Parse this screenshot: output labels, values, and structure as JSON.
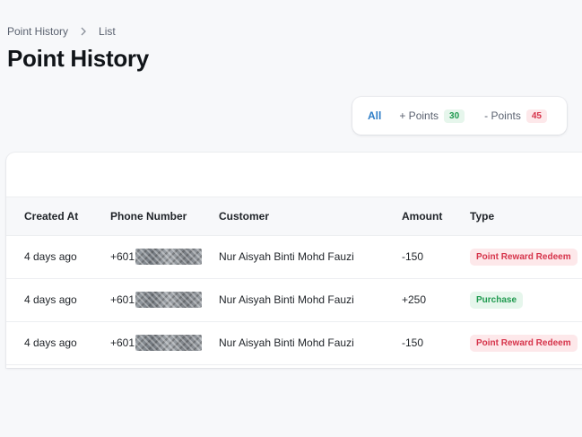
{
  "breadcrumb": {
    "parent": "Point History",
    "current": "List"
  },
  "page_title": "Point History",
  "filters": {
    "all": "All",
    "plus": {
      "label": "+ Points",
      "count": "30"
    },
    "minus": {
      "label": "- Points",
      "count": "45"
    }
  },
  "table": {
    "headers": [
      "Created At",
      "Phone Number",
      "Customer",
      "Amount",
      "Type"
    ],
    "rows": [
      {
        "created_at": "4 days ago",
        "phone_prefix": "+601",
        "customer": "Nur Aisyah Binti Mohd Fauzi",
        "amount": "-150",
        "type": "Point Reward Redeem",
        "type_color": "red"
      },
      {
        "created_at": "4 days ago",
        "phone_prefix": "+601",
        "customer": "Nur Aisyah Binti Mohd Fauzi",
        "amount": "+250",
        "type": "Purchase",
        "type_color": "green"
      },
      {
        "created_at": "4 days ago",
        "phone_prefix": "+601",
        "customer": "Nur Aisyah Binti Mohd Fauzi",
        "amount": "-150",
        "type": "Point Reward Redeem",
        "type_color": "red"
      }
    ]
  },
  "colors": {
    "accent": "#2f7ec7",
    "positive": "#1f9a4f",
    "negative": "#d6334a"
  }
}
